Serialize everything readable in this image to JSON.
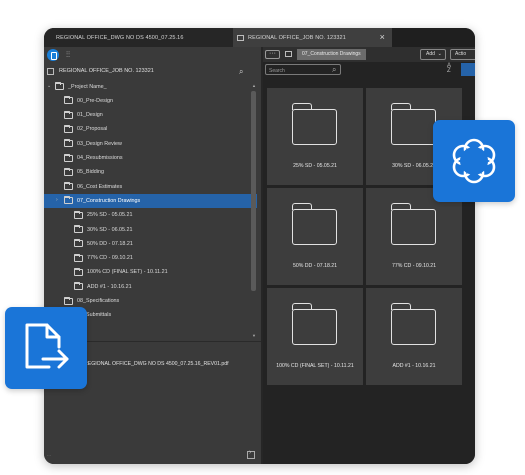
{
  "tabs": [
    {
      "label": "REGIONAL OFFICE_DWG NO DS 4500_07.25.16"
    },
    {
      "label": "REGIONAL OFFICE_JOB NO. 123321"
    }
  ],
  "tab_close": "×",
  "left": {
    "project_label": "REGIONAL OFFICE_JOB NO. 123321",
    "tree": [
      {
        "label": "_Project Name_",
        "level": 0,
        "expanded": true
      },
      {
        "label": "00_Pre-Design",
        "level": 1
      },
      {
        "label": "01_Design",
        "level": 1
      },
      {
        "label": "02_Proposal",
        "level": 1
      },
      {
        "label": "03_Design Review",
        "level": 1
      },
      {
        "label": "04_Resubmissions",
        "level": 1
      },
      {
        "label": "05_Bidding",
        "level": 1
      },
      {
        "label": "06_Cost Estimates",
        "level": 1
      },
      {
        "label": "07_Construction Drawings",
        "level": 1,
        "selected": true
      },
      {
        "label": "25% SD - 05.05.21",
        "level": 2
      },
      {
        "label": "30% SD - 06.05.21",
        "level": 2
      },
      {
        "label": "50% DD - 07.18.21",
        "level": 2
      },
      {
        "label": "77% CD - 09.10.21",
        "level": 2
      },
      {
        "label": "100% CD (FINAL SET) - 10.11.21",
        "level": 2
      },
      {
        "label": "ADD #1 - 10.16.21",
        "level": 2
      },
      {
        "label": "08_Specifications",
        "level": 1
      },
      {
        "label": "09_Submittals",
        "level": 1
      }
    ],
    "file_label": "REGIONAL OFFICE_DWG NO DS 4500_07.25.16_REV01.pdf"
  },
  "right": {
    "more_label": "···",
    "breadcrumb": "07_Construction Drawings",
    "add_label": "Add",
    "actions_label": "Actio",
    "search_placeholder": "Search",
    "folders": [
      {
        "label": "25% SD - 05.05.21"
      },
      {
        "label": "30% SD - 06.05.21"
      },
      {
        "label": "50% DD - 07.18.21"
      },
      {
        "label": "77% CD - 09.10.21"
      },
      {
        "label": "100% CD (FINAL SET) - 10.11.21"
      },
      {
        "label": "ADD #1 - 10.16.21"
      }
    ]
  },
  "icons": {
    "logo": "app-logo-icon",
    "filter": "filter-sliders-icon",
    "search": "search-icon",
    "sort": "sort-az-icon",
    "view": "grid-view-icon",
    "badge_top": "flower-shape-icon",
    "badge_bottom": "file-export-icon"
  },
  "colors": {
    "accent": "#2563a9",
    "badge": "#1a75d8",
    "panel": "#3a3a3a",
    "dark": "#232323"
  }
}
